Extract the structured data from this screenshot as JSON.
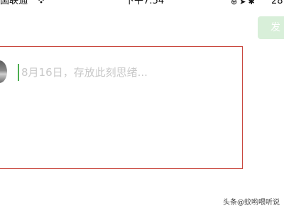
{
  "status_bar": {
    "carrier": "国联通",
    "wifi_icon": "wifi-icon",
    "time": "下午7:54",
    "indicator_icons": [
      "orientation-lock-icon",
      "location-icon",
      "bluetooth-icon"
    ],
    "battery_percent": "28"
  },
  "toolbar": {
    "send_label": "发"
  },
  "compose": {
    "placeholder": "8月16日，存放此刻思绪..."
  },
  "watermark": {
    "text": "头条@蚊哟喂听说"
  },
  "colors": {
    "send_button_bg": "#d8efd9",
    "highlight_border": "#c9473e",
    "cursor": "#4cae50",
    "placeholder_text": "#c9c9c9"
  }
}
